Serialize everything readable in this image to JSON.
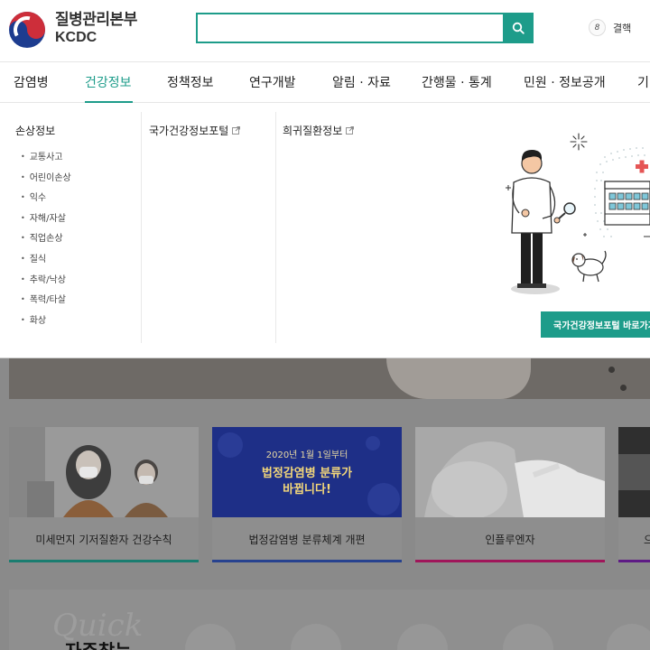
{
  "header": {
    "logo_ko": "질병관리본부",
    "logo_en": "KCDC",
    "search_placeholder": "",
    "util_count": "8",
    "util_label": "결핵"
  },
  "gnb": {
    "items": [
      {
        "label": "감염병"
      },
      {
        "label": "건강정보"
      },
      {
        "label": "정책정보"
      },
      {
        "label": "연구개발"
      },
      {
        "label": "알림 · 자료"
      },
      {
        "label": "간행물 · 통계"
      },
      {
        "label": "민원 · 정보공개"
      },
      {
        "label": "기"
      }
    ],
    "active_index": 1
  },
  "mega": {
    "col1_title": "손상정보",
    "col1_items": [
      "교통사고",
      "어린이손상",
      "익수",
      "자해/자살",
      "직업손상",
      "질식",
      "추락/낙상",
      "폭력/타살",
      "화상"
    ],
    "col2_title": "국가건강정보포털",
    "col3_title": "희귀질환정보",
    "portal_button": "국가건강정보포털 바로가기"
  },
  "cards": [
    {
      "caption": "미세먼지 기저질환자 건강수칙",
      "accent": "#1d9c8a"
    },
    {
      "caption": "법정감염병 분류체계 개편",
      "accent": "#2b4aa5",
      "banner_line1": "2020년 1월 1일부터",
      "banner_line2": "법정감염병 분류가",
      "banner_line3": "바뀝니다!"
    },
    {
      "caption": "인플루엔자",
      "accent": "#c2185b"
    },
    {
      "caption": "으",
      "accent": "#6a1b9a"
    }
  ],
  "quick": {
    "script": "Quick",
    "title": "자주찾는"
  },
  "colors": {
    "accent": "#1d9c8a",
    "banner_blue": "#1e2f87"
  }
}
